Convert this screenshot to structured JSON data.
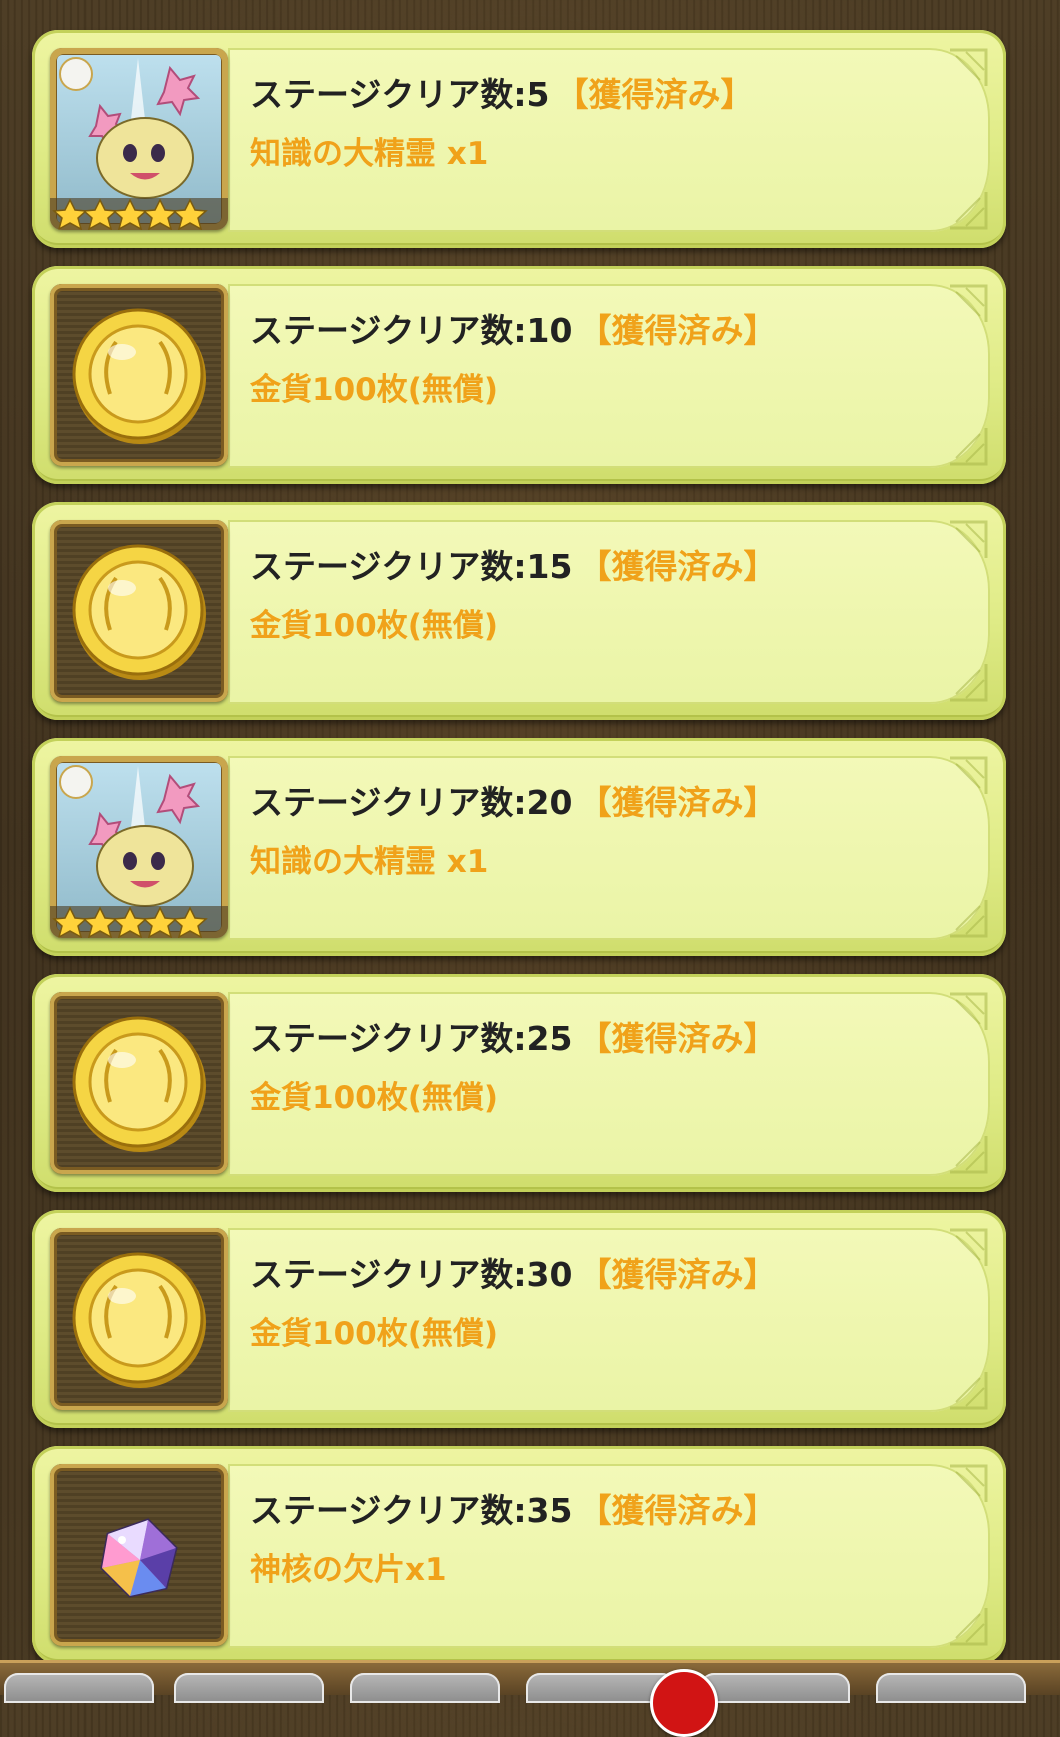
{
  "missions": [
    {
      "title": "ステージクリア数:5",
      "status": "【獲得済み】",
      "reward": "知識の大精霊 x1",
      "icon": "spirit-icon"
    },
    {
      "title": "ステージクリア数:10",
      "status": "【獲得済み】",
      "reward": "金貨100枚(無償)",
      "icon": "gold-coin-icon"
    },
    {
      "title": "ステージクリア数:15",
      "status": "【獲得済み】",
      "reward": "金貨100枚(無償)",
      "icon": "gold-coin-icon"
    },
    {
      "title": "ステージクリア数:20",
      "status": "【獲得済み】",
      "reward": "知識の大精霊 x1",
      "icon": "spirit-icon"
    },
    {
      "title": "ステージクリア数:25",
      "status": "【獲得済み】",
      "reward": "金貨100枚(無償)",
      "icon": "gold-coin-icon"
    },
    {
      "title": "ステージクリア数:30",
      "status": "【獲得済み】",
      "reward": "金貨100枚(無償)",
      "icon": "gold-coin-icon"
    },
    {
      "title": "ステージクリア数:35",
      "status": "【獲得済み】",
      "reward": "神核の欠片x1",
      "icon": "crystal-shard-icon"
    }
  ],
  "colors": {
    "card": "#e6f09a",
    "reward_text": "#f0a21a",
    "title_text": "#222222"
  }
}
